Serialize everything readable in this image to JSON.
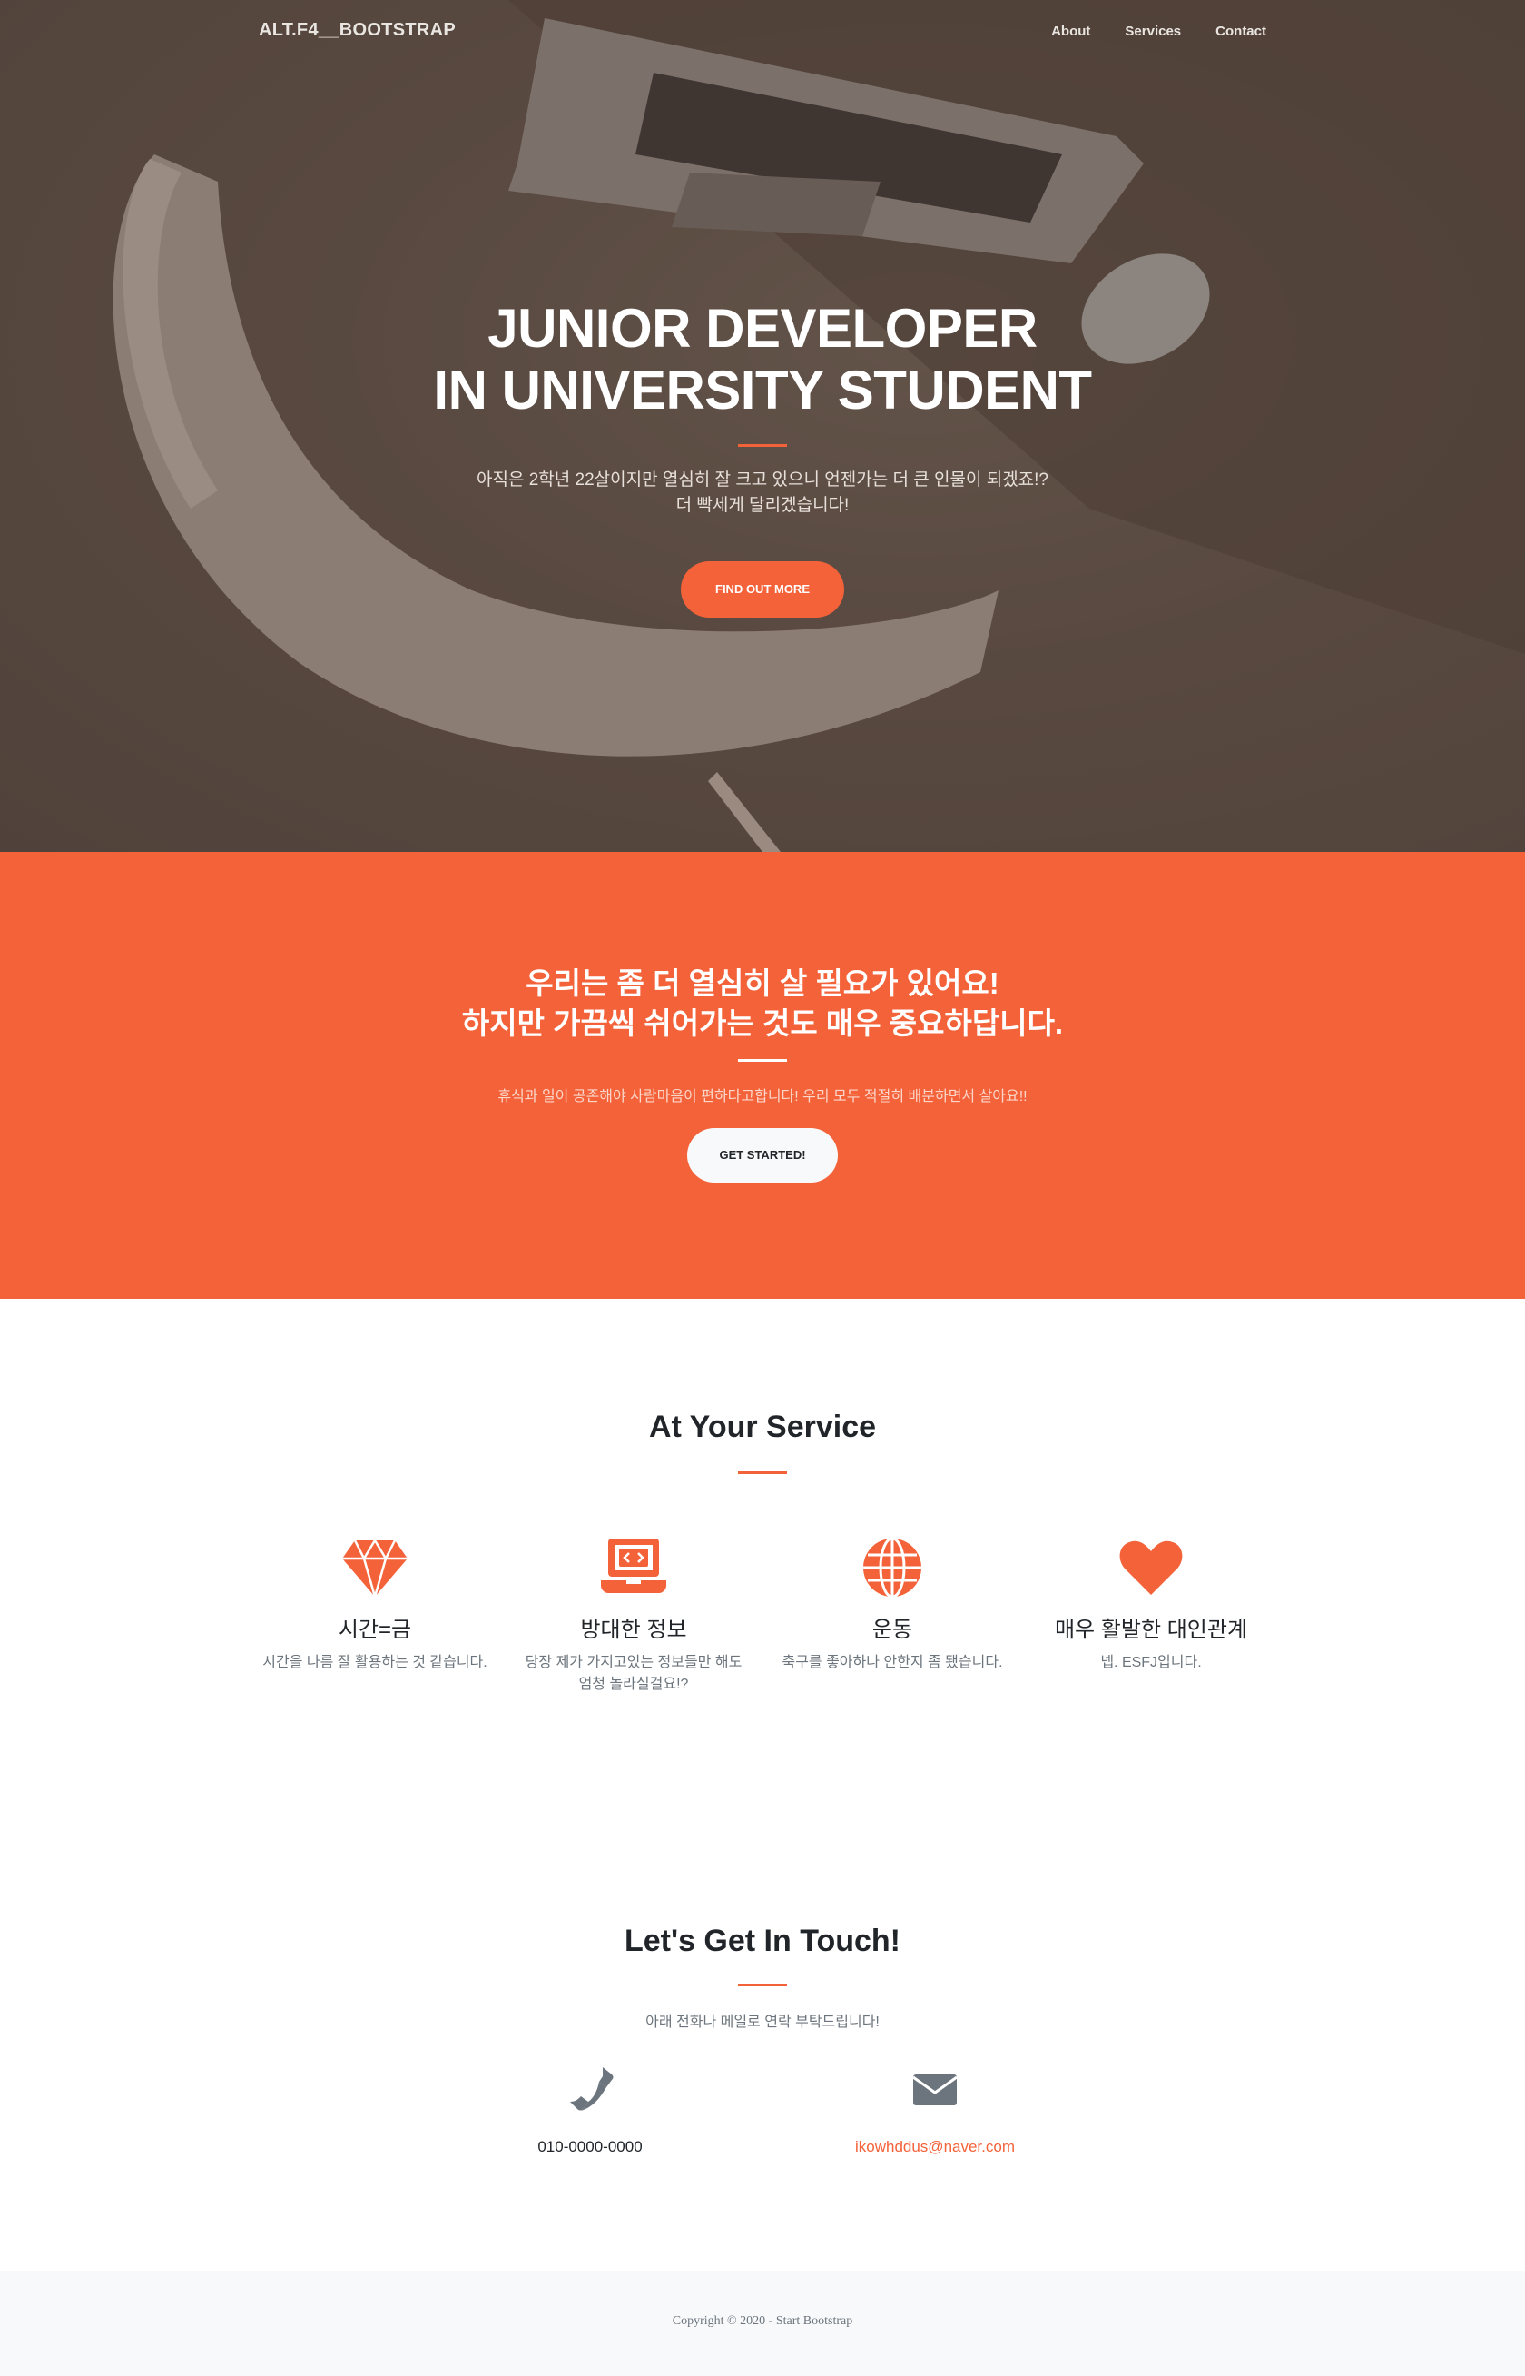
{
  "nav": {
    "brand": "ALT.F4__BOOTSTRAP",
    "links": [
      "About",
      "Services",
      "Contact"
    ]
  },
  "hero": {
    "title_line1": "JUNIOR DEVELOPER",
    "title_line2": "IN UNIVERSITY STUDENT",
    "subtitle_line1": "아직은 2학년 22살이지만 열심히 잘 크고 있으니 언젠가는 더 큰 인물이 되겠죠!?",
    "subtitle_line2": "더 빡세게 달리겠습니다!",
    "button": "FIND OUT MORE"
  },
  "cta": {
    "title_line1": "우리는 좀 더 열심히 살 필요가 있어요!",
    "title_line2": "하지만 가끔씩 쉬어가는 것도 매우 중요하답니다.",
    "subtitle": "휴식과 일이 공존해야 사람마음이 편하다고합니다! 우리 모두 적절히 배분하면서 살아요!!",
    "button": "GET STARTED!"
  },
  "services": {
    "title": "At Your Service",
    "items": [
      {
        "icon": "gem-icon",
        "name": "시간=금",
        "desc": "시간을 나름 잘 활용하는 것 같습니다."
      },
      {
        "icon": "laptop-code-icon",
        "name": "방대한 정보",
        "desc": "당장 제가 가지고있는 정보들만 해도 엄청 놀라실걸요!?"
      },
      {
        "icon": "globe-icon",
        "name": "운동",
        "desc": "축구를 좋아하나 안한지 좀 됐습니다."
      },
      {
        "icon": "heart-icon",
        "name": "매우 활발한 대인관계",
        "desc": "넵. ESFJ입니다."
      }
    ]
  },
  "contact": {
    "title": "Let's Get In Touch!",
    "subtitle": "아래 전화나 메일로 연락 부탁드립니다!",
    "phone": "010-0000-0000",
    "email": "ikowhddus@naver.com"
  },
  "footer": {
    "copyright": "Copyright © 2020 - Start Bootstrap"
  },
  "colors": {
    "accent": "#f4623a",
    "hero_bg": "#5a4a41",
    "footer_bg": "#f8f9fa",
    "icon_gray": "#6c757d"
  }
}
